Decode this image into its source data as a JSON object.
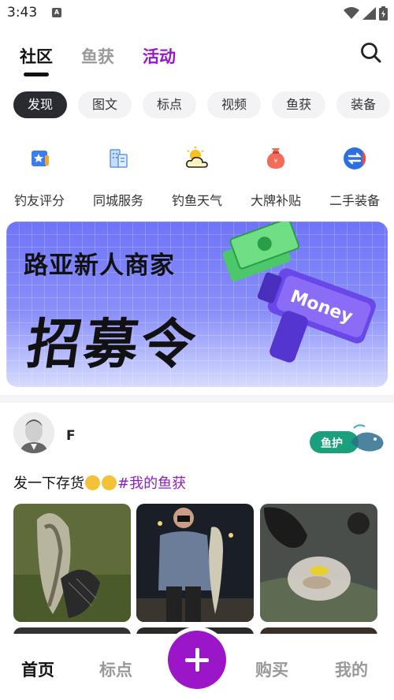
{
  "status": {
    "time": "3:43",
    "sim_icon": "A"
  },
  "top_tabs": [
    {
      "label": "社区",
      "color": "#111111"
    },
    {
      "label": "鱼获",
      "color": "#9a9a9a"
    },
    {
      "label": "活动",
      "color": "#9b16c8"
    }
  ],
  "chips": [
    "发现",
    "图文",
    "标点",
    "视频",
    "鱼获",
    "装备"
  ],
  "shortcuts": [
    {
      "label": "钓友评分",
      "icon": "star-card-icon"
    },
    {
      "label": "同城服务",
      "icon": "building-icon"
    },
    {
      "label": "钓鱼天气",
      "icon": "sun-cloud-icon"
    },
    {
      "label": "大牌补贴",
      "icon": "money-bag-icon"
    },
    {
      "label": "二手装备",
      "icon": "exchange-icon"
    }
  ],
  "banner": {
    "line1": "路亚新人商家",
    "line2": "招募令",
    "gun_text": "Money"
  },
  "post": {
    "author": "F",
    "badge": "鱼护",
    "text": "发一下存货",
    "hashtag": "#我的鱼获"
  },
  "nav": {
    "home": "首页",
    "spots": "标点",
    "buy": "购买",
    "mine": "我的"
  },
  "colors": {
    "accent": "#9b16c8",
    "chip_active": "#2a2b30",
    "badge_green": "#1aa07c"
  }
}
